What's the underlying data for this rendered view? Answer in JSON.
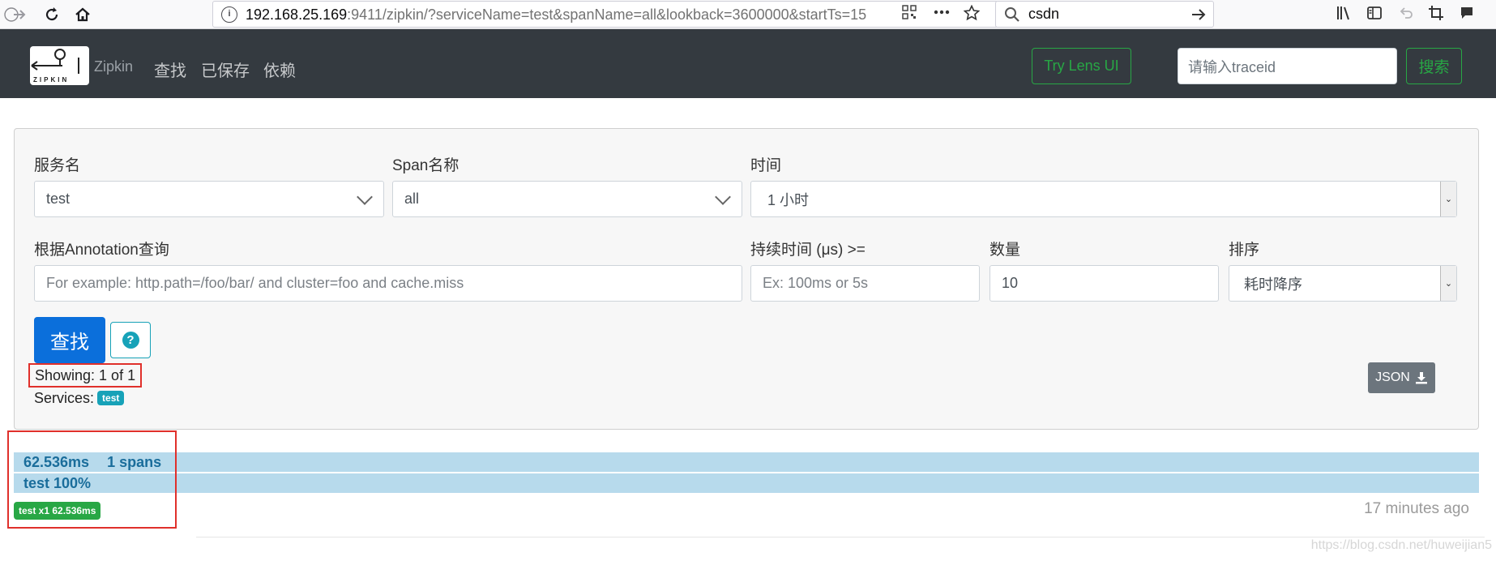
{
  "browser": {
    "url_host": "192.168.25.169",
    "url_rest": ":9411/zipkin/?serviceName=test&spanName=all&lookback=3600000&startTs=15",
    "search_text": "csdn"
  },
  "header": {
    "logo_word": "ZIPKIN",
    "brand": "Zipkin",
    "nav": [
      "查找",
      "已保存",
      "依赖"
    ],
    "lens_button": "Try Lens UI",
    "traceid_placeholder": "请输入traceid",
    "search_button": "搜索"
  },
  "form": {
    "service_label": "服务名",
    "service_value": "test",
    "span_label": "Span名称",
    "span_value": "all",
    "time_label": "时间",
    "time_value": "1 小时",
    "annotation_label": "根据Annotation查询",
    "annotation_placeholder": "For example: http.path=/foo/bar/ and cluster=foo and cache.miss",
    "duration_label": "持续时间 (μs) >=",
    "duration_placeholder": "Ex: 100ms or 5s",
    "limit_label": "数量",
    "limit_value": "10",
    "sort_label": "排序",
    "sort_value": "耗时降序",
    "find_button": "查找",
    "help_icon_text": "?",
    "showing": "Showing: 1 of 1",
    "services_label": "Services:",
    "services_badge": "test",
    "json_button": "JSON"
  },
  "result": {
    "duration": "62.536ms",
    "spans": "1 spans",
    "service_percent": "test 100%",
    "badge": "test x1 62.536ms",
    "ago": "17 minutes ago",
    "bar_fraction": 1.0
  },
  "watermark": "https://blog.csdn.net/huweijian5",
  "colors": {
    "header_bg": "#343a40",
    "accent_green": "#28a745",
    "primary_blue": "#0b6fdb",
    "info_teal": "#17a2b8",
    "bar_blue": "#b7daec",
    "highlight_red": "#e0302b"
  },
  "icons": {
    "back": "arrow-left-icon",
    "forward": "arrow-right-icon",
    "reload": "reload-icon",
    "home": "home-icon",
    "info": "info-icon",
    "qr": "qr-code-icon",
    "more": "ellipsis-icon",
    "bookmark": "star-icon",
    "search": "search-icon",
    "go": "arrow-right-icon",
    "library": "library-icon",
    "sidebar": "sidebar-icon",
    "undo": "undo-icon",
    "screenshot": "crop-icon",
    "chat": "chat-icon",
    "download": "download-icon"
  }
}
